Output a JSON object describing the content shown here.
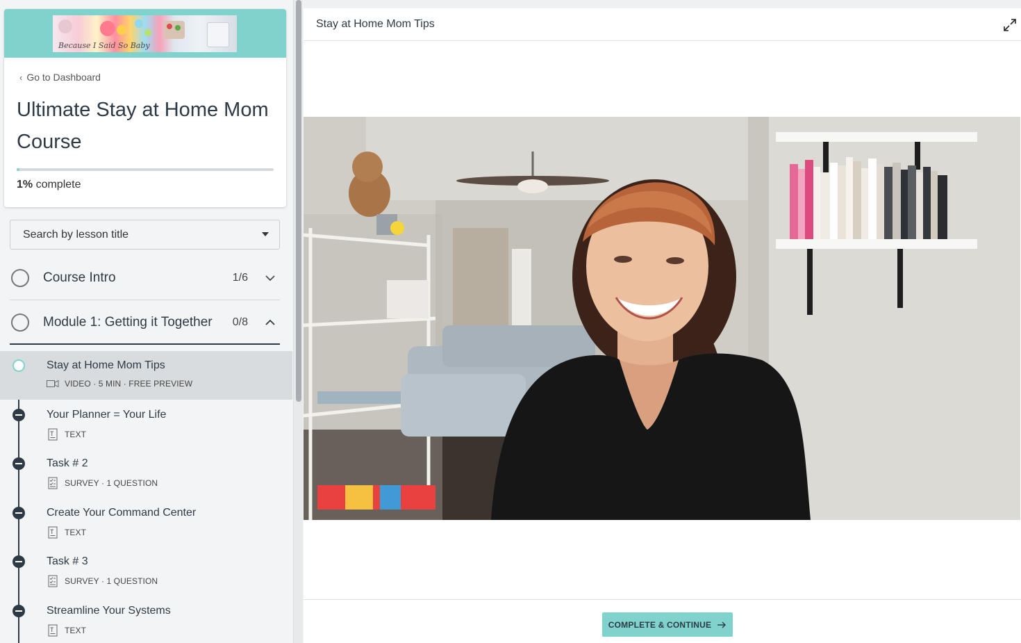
{
  "sidebar": {
    "banner_script": "Because I Said So Baby",
    "back_link": "Go to Dashboard",
    "course_title": "Ultimate Stay at Home Mom Course",
    "progress_percent": 1,
    "progress_value": "1%",
    "progress_suffix": "complete",
    "search_placeholder": "Search by lesson title",
    "chapters": [
      {
        "title": "Course Intro",
        "count": "1/6",
        "expanded": false
      },
      {
        "title": "Module 1: Getting it Together",
        "count": "0/8",
        "expanded": true
      }
    ],
    "lessons": [
      {
        "title": "Stay at Home Mom Tips",
        "type_icon": "video-icon",
        "meta": "VIDEO · 5 MIN · FREE PREVIEW",
        "active": true
      },
      {
        "title": "Your Planner = Your Life",
        "type_icon": "text-icon",
        "meta": "TEXT",
        "active": false
      },
      {
        "title": "Task # 2",
        "type_icon": "survey-icon",
        "meta": "SURVEY · 1 QUESTION",
        "active": false
      },
      {
        "title": "Create Your Command Center",
        "type_icon": "text-icon",
        "meta": "TEXT",
        "active": false
      },
      {
        "title": "Task # 3",
        "type_icon": "survey-icon",
        "meta": "SURVEY · 1 QUESTION",
        "active": false
      },
      {
        "title": "Streamline Your Systems",
        "type_icon": "text-icon",
        "meta": "TEXT",
        "active": false
      }
    ]
  },
  "main": {
    "lesson_title": "Stay at Home Mom Tips",
    "complete_button": "COMPLETE & CONTINUE"
  },
  "colors": {
    "accent": "#7fd3cc",
    "text_dark": "#2d3a45",
    "sidebar_bg": "#f3f4f5",
    "active_row": "#d9dcdf"
  }
}
